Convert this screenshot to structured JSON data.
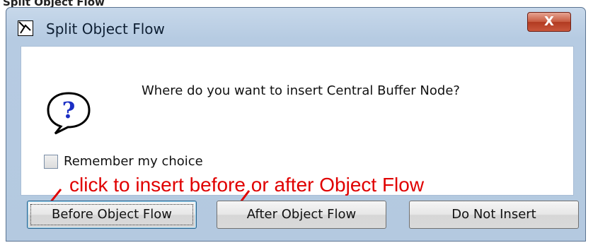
{
  "page": {
    "top_cut_text": "Split Object Flow"
  },
  "window": {
    "title": "Split Object Flow",
    "close_glyph": "X",
    "icons": {
      "title": "split-flow-icon",
      "question": "question-mark-icon"
    }
  },
  "dialog": {
    "message": "Where do you want to insert Central Buffer Node?",
    "remember_label": "Remember my choice",
    "remember_checked": false
  },
  "annotation": {
    "text": "click to insert before or after Object Flow",
    "color": "#e00000"
  },
  "buttons": {
    "before": "Before Object Flow",
    "after": "After Object Flow",
    "do_not_insert": "Do Not Insert"
  }
}
